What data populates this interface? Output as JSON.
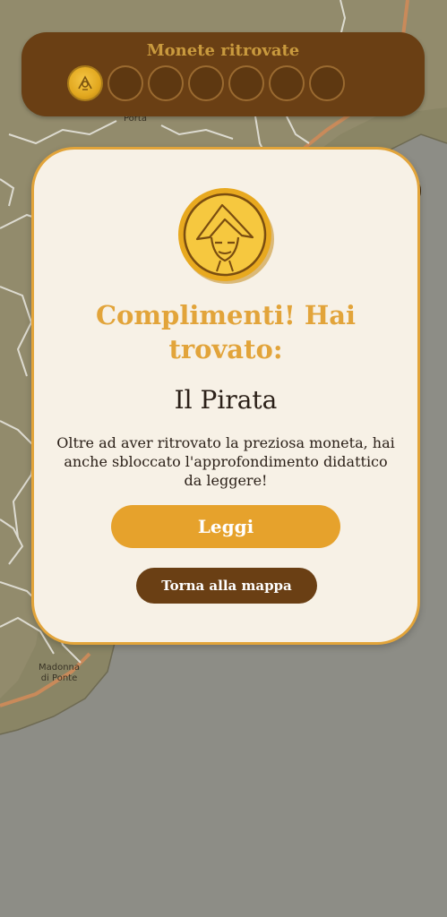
{
  "coins_bar": {
    "title": "Monete ritrovate",
    "slots": [
      {
        "state": "found"
      },
      {
        "state": "empty"
      },
      {
        "state": "empty"
      },
      {
        "state": "empty"
      },
      {
        "state": "empty"
      },
      {
        "state": "empty"
      },
      {
        "state": "empty"
      }
    ]
  },
  "map": {
    "labels": {
      "porta": "Porta",
      "madonna_line1": "Madonna",
      "madonna_line2": "di Ponte"
    }
  },
  "modal": {
    "coin_icon": "pirate-coin-icon",
    "heading": "Complimenti! Hai trovato:",
    "character_name": "Il Pirata",
    "description": "Oltre ad aver ritrovato la preziosa moneta, hai anche sbloccato l'approfondimento didattico da leggere!",
    "read_button_label": "Leggi",
    "back_to_map_label": "Torna alla mappa"
  },
  "colors": {
    "accent_gold": "#e2a43a",
    "dark_brown": "#6a3f14",
    "panel_cream": "#f7f1e6"
  }
}
